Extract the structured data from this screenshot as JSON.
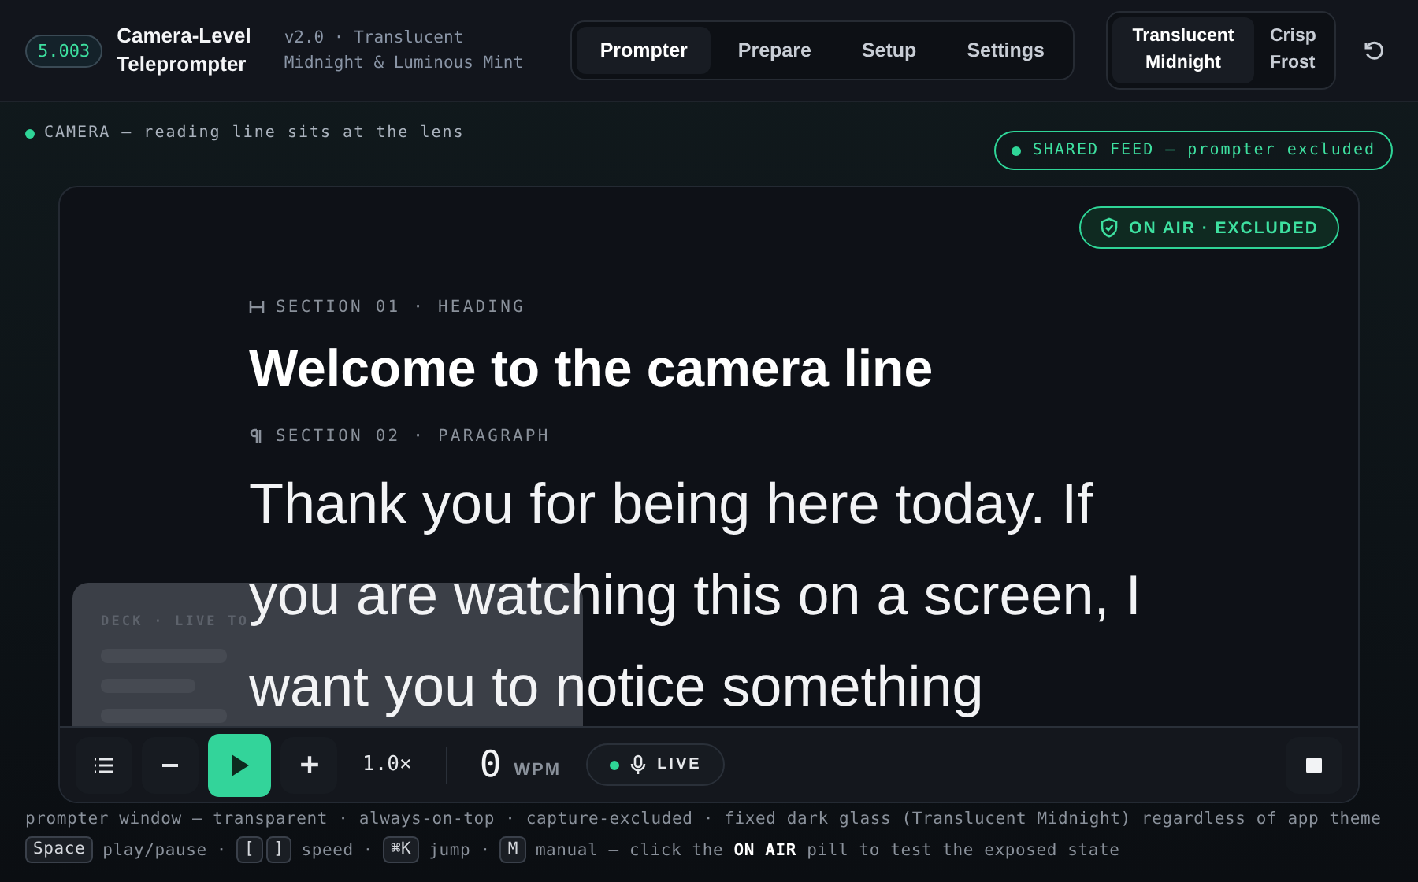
{
  "app": {
    "badge": "5.003",
    "title": "Camera-Level Teleprompter",
    "subtitle": "v2.0 · Translucent Midnight & Luminous Mint"
  },
  "nav_tabs": [
    {
      "label": "Prompter",
      "selected": true
    },
    {
      "label": "Prepare",
      "selected": false
    },
    {
      "label": "Setup",
      "selected": false
    },
    {
      "label": "Settings",
      "selected": false
    }
  ],
  "theme_toggle": [
    {
      "label": "Translucent Midnight",
      "selected": true
    },
    {
      "label": "Crisp Frost",
      "selected": false
    }
  ],
  "camera_status": "CAMERA — reading line sits at the lens",
  "shared_feed": "SHARED FEED — prompter excluded",
  "on_air": "ON AIR · EXCLUDED",
  "sections": [
    {
      "kind": "heading",
      "label": "SECTION 01 · HEADING",
      "text": "Welcome to the camera line"
    },
    {
      "kind": "paragraph",
      "label": "SECTION 02 · PARAGRAPH",
      "text": "Thank you for being here today. If you are watching this on a screen, I want you to notice something"
    }
  ],
  "deck": {
    "title": "DECK · LIVE TO"
  },
  "controls": {
    "speed": "1.0×",
    "wpm_value": "0",
    "wpm_unit": "WPM",
    "live": "LIVE"
  },
  "footer": {
    "separator": "·",
    "note": "prompter window — transparent · always-on-top · capture-excluded · fixed dark glass (Translucent Midnight) regardless of app theme",
    "shortcuts": [
      {
        "keys": [
          "Space"
        ],
        "action": "play/pause"
      },
      {
        "keys": [
          "[",
          "]"
        ],
        "action": "speed"
      },
      {
        "keys": [
          "⌘K"
        ],
        "action": "jump"
      },
      {
        "keys": [
          "M"
        ],
        "action": "manual — click the **ON AIR** pill to test the exposed state"
      }
    ]
  }
}
